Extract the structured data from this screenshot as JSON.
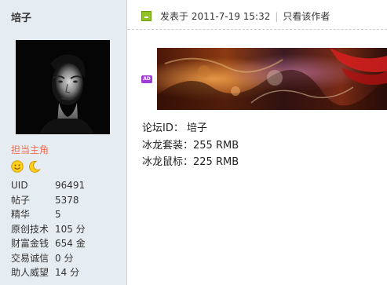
{
  "user": {
    "name": "培子",
    "rank": "担当主角",
    "medals": [
      "smile-medal-icon",
      "moon-medal-icon"
    ],
    "stats": [
      {
        "key": "UID",
        "value": "96491"
      },
      {
        "key": "帖子",
        "value": "5378"
      },
      {
        "key": "精华",
        "value": "5"
      },
      {
        "key": "原创技术",
        "value": "105 分"
      },
      {
        "key": "财富金钱",
        "value": "654 金"
      },
      {
        "key": "交易诚信",
        "value": "0 分"
      },
      {
        "key": "助人威望",
        "value": "14 分"
      }
    ]
  },
  "post": {
    "published_label": "发表于",
    "published_time": "2011-7-19 15:32",
    "author_only": "只看该作者",
    "ad_badge": "AD",
    "content": [
      "论坛ID： 培子",
      "冰龙套装：255 RMB",
      "冰龙鼠标：225 RMB"
    ]
  },
  "colors": {
    "sidebar_bg": "#e5edf2",
    "rank_color": "#f26c4f",
    "post_icon": "#8fc31f",
    "ad_badge": "#a13bd6"
  }
}
